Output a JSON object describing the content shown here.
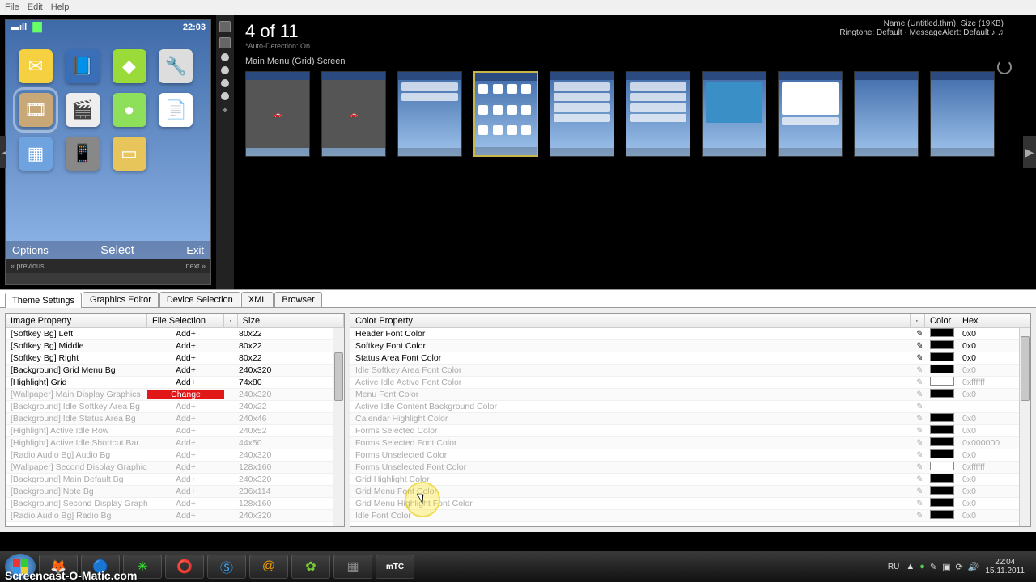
{
  "menu": {
    "file": "File",
    "edit": "Edit",
    "help": "Help"
  },
  "phone": {
    "time": "22:03",
    "softkeys": {
      "left": "Options",
      "mid": "Select",
      "right": "Exit"
    },
    "nav": {
      "prev": "« previous",
      "next": "next »"
    },
    "apps": [
      "✉",
      "📘",
      "🔷",
      "🔧",
      "🎞",
      "🎬",
      "🟢",
      "📄",
      "🔲",
      "📱",
      "💳",
      ""
    ]
  },
  "header": {
    "counter": "4 of 11",
    "auto": "*Auto-Detection: On",
    "name_label": "Name",
    "name_value": "(Untitled.thm)",
    "size_label": "Size",
    "size_value": "(19KB)",
    "ringtone": "Ringtone: Default · MessageAlert: Default ♪ ♫",
    "screen_title": "Main Menu (Grid) Screen"
  },
  "tabs": [
    "Theme Settings",
    "Graphics Editor",
    "Device Selection",
    "XML",
    "Browser"
  ],
  "image_table": {
    "cols": {
      "prop": "Image Property",
      "file": "File Selection",
      "size": "Size"
    },
    "rows": [
      {
        "prop": "[Softkey Bg] Left",
        "file": "Add+",
        "size": "80x22",
        "dim": false
      },
      {
        "prop": "[Softkey Bg] Middle",
        "file": "Add+",
        "size": "80x22",
        "dim": false
      },
      {
        "prop": "[Softkey Bg] Right",
        "file": "Add+",
        "size": "80x22",
        "dim": false
      },
      {
        "prop": "[Background] Grid Menu Bg",
        "file": "Add+",
        "size": "240x320",
        "dim": false
      },
      {
        "prop": "[Highlight] Grid",
        "file": "Add+",
        "size": "74x80",
        "dim": false
      },
      {
        "prop": "[Wallpaper] Main Display Graphics",
        "file": "Change",
        "size": "240x320",
        "dim": true,
        "red": true
      },
      {
        "prop": "[Background] Idle Softkey Area Bg",
        "file": "Add+",
        "size": "240x22",
        "dim": true
      },
      {
        "prop": "[Background] Idle Status Area Bg",
        "file": "Add+",
        "size": "240x46",
        "dim": true
      },
      {
        "prop": "[Highlight] Active Idle Row",
        "file": "Add+",
        "size": "240x52",
        "dim": true
      },
      {
        "prop": "[Highlight] Active Idle Shortcut Bar",
        "file": "Add+",
        "size": "44x50",
        "dim": true
      },
      {
        "prop": "[Radio Audio Bg] Audio Bg",
        "file": "Add+",
        "size": "240x320",
        "dim": true
      },
      {
        "prop": "[Wallpaper] Second Display Graphics",
        "file": "Add+",
        "size": "128x160",
        "dim": true
      },
      {
        "prop": "[Background] Main Default Bg",
        "file": "Add+",
        "size": "240x320",
        "dim": true
      },
      {
        "prop": "[Background] Note Bg",
        "file": "Add+",
        "size": "236x114",
        "dim": true
      },
      {
        "prop": "[Background] Second Display Graphics",
        "file": "Add+",
        "size": "128x160",
        "dim": true
      },
      {
        "prop": "[Radio Audio Bg] Radio Bg",
        "file": "Add+",
        "size": "240x320",
        "dim": true
      }
    ]
  },
  "color_table": {
    "cols": {
      "prop": "Color Property",
      "color": "Color",
      "hex": "Hex"
    },
    "rows": [
      {
        "prop": "Header Font Color",
        "hex": "0x0",
        "sw": "black",
        "dim": false
      },
      {
        "prop": "Softkey Font Color",
        "hex": "0x0",
        "sw": "black",
        "dim": false
      },
      {
        "prop": "Status Area Font Color",
        "hex": "0x0",
        "sw": "black",
        "dim": false
      },
      {
        "prop": "Idle Softkey Area Font Color",
        "hex": "0x0",
        "sw": "black",
        "dim": true
      },
      {
        "prop": "Active Idle Active Font Color",
        "hex": "0xffffff",
        "sw": "white",
        "dim": true
      },
      {
        "prop": "Menu Font Color",
        "hex": "0x0",
        "sw": "black",
        "dim": true
      },
      {
        "prop": "Active Idle Content Background Color",
        "hex": "",
        "sw": "",
        "dim": true
      },
      {
        "prop": "Calendar Highlight Color",
        "hex": "0x0",
        "sw": "black",
        "dim": true
      },
      {
        "prop": "Forms Selected Color",
        "hex": "0x0",
        "sw": "black",
        "dim": true
      },
      {
        "prop": "Forms Selected Font Color",
        "hex": "0x000000",
        "sw": "black",
        "dim": true
      },
      {
        "prop": "Forms Unselected Color",
        "hex": "0x0",
        "sw": "black",
        "dim": true
      },
      {
        "prop": "Forms Unselected Font Color",
        "hex": "0xffffff",
        "sw": "white",
        "dim": true
      },
      {
        "prop": "Grid Highlight Color",
        "hex": "0x0",
        "sw": "black",
        "dim": true
      },
      {
        "prop": "Grid Menu Font Color",
        "hex": "0x0",
        "sw": "black",
        "dim": true
      },
      {
        "prop": "Grid Menu Highlight Font Color",
        "hex": "0x0",
        "sw": "black",
        "dim": true
      },
      {
        "prop": "Idle Font Color",
        "hex": "0x0",
        "sw": "black",
        "dim": true
      }
    ]
  },
  "taskbar": {
    "lang": "RU",
    "time": "22:04",
    "date": "15.11.2011",
    "apps": [
      "🦊",
      "⭕",
      "🐞",
      "🔴",
      "🔵",
      "@",
      "✳",
      "▦",
      "mTC"
    ]
  },
  "watermark": "Screencast-O-Matic.com"
}
